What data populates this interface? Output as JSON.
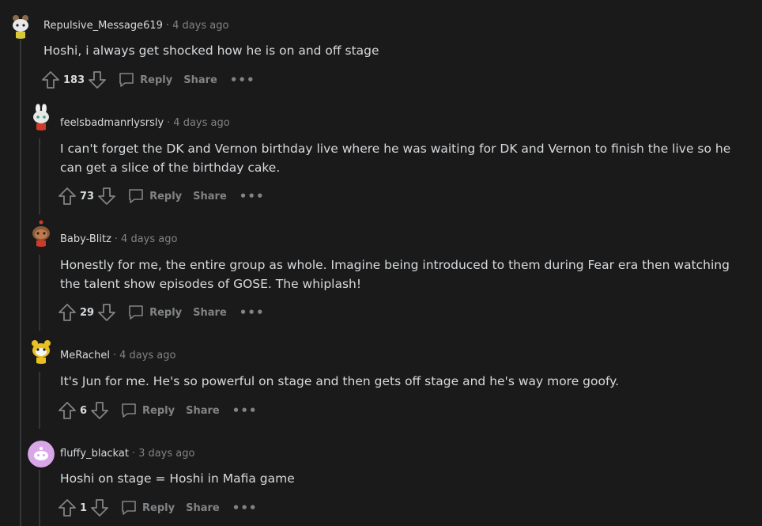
{
  "comments": [
    {
      "author": "Repulsive_Message619",
      "time": "4 days ago",
      "text": "Hoshi, i always get shocked how he is on and off stage",
      "score": "183",
      "reply_label": "Reply",
      "share_label": "Share",
      "more_label": "•••"
    },
    {
      "author": "feelsbadmanrlysrsly",
      "time": "4 days ago",
      "text": "I can't forget the DK and Vernon birthday live where he was waiting for DK and Vernon to finish the live so he can get a slice of the birthday cake.",
      "score": "73",
      "reply_label": "Reply",
      "share_label": "Share",
      "more_label": "•••"
    },
    {
      "author": "Baby-Blitz",
      "time": "4 days ago",
      "text": "Honestly for me, the entire group as whole. Imagine being introduced to them during Fear era then watching the talent show episodes of GOSE. The whiplash!",
      "score": "29",
      "reply_label": "Reply",
      "share_label": "Share",
      "more_label": "•••"
    },
    {
      "author": "MeRachel",
      "time": "4 days ago",
      "text": "It's Jun for me. He's so powerful on stage and then gets off stage and he's way more goofy.",
      "score": "6",
      "reply_label": "Reply",
      "share_label": "Share",
      "more_label": "•••"
    },
    {
      "author": "fluffy_blackat",
      "time": "3 days ago",
      "text": "Hoshi on stage = Hoshi in Mafia game",
      "score": "1",
      "reply_label": "Reply",
      "share_label": "Share",
      "more_label": "•••"
    }
  ],
  "separator": "·",
  "colors": {
    "background": "#1a1a1b",
    "text": "#d7dadc",
    "muted": "#818384",
    "thread_line": "#343536"
  }
}
